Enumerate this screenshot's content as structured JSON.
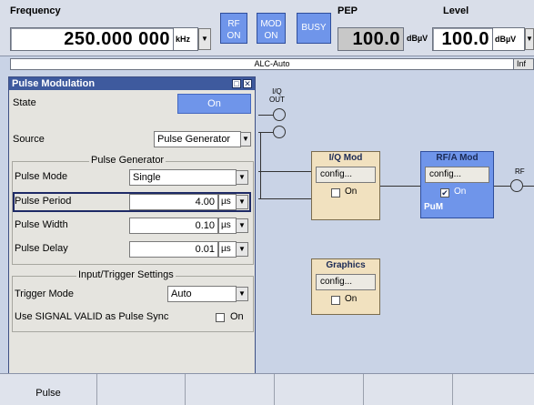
{
  "header": {
    "frequency_label": "Frequency",
    "frequency_value": "250.000 000",
    "frequency_unit": "kHz",
    "rf_button": "RF\nON",
    "mod_button": "MOD\nON",
    "busy_button": "BUSY",
    "pep_label": "PEP",
    "pep_value": "100.0",
    "pep_unit": "dBµV",
    "level_label": "Level",
    "level_value": "100.0",
    "level_unit": "dBµV"
  },
  "alc": {
    "text": "ALC-Auto",
    "info_button": "Inf"
  },
  "dialog": {
    "title": "Pulse Modulation",
    "state_label": "State",
    "state_value": "On",
    "source_label": "Source",
    "source_value": "Pulse Generator",
    "pulse_generator_group": "Pulse Generator",
    "pulse_mode_label": "Pulse Mode",
    "pulse_mode_value": "Single",
    "pulse_period_label": "Pulse Period",
    "pulse_period_value": "4.00",
    "pulse_period_unit": "µs",
    "pulse_width_label": "Pulse Width",
    "pulse_width_value": "0.10",
    "pulse_width_unit": "µs",
    "pulse_delay_label": "Pulse Delay",
    "pulse_delay_value": "0.01",
    "pulse_delay_unit": "µs",
    "trigger_group": "Input/Trigger Settings",
    "trigger_mode_label": "Trigger Mode",
    "trigger_mode_value": "Auto",
    "signal_valid_label": "Use SIGNAL VALID as Pulse Sync",
    "signal_valid_checkbox_label": "On"
  },
  "diagram": {
    "iq_out_label": "I/Q\nOUT",
    "iq_mod_title": "I/Q Mod",
    "iq_mod_config": "config...",
    "iq_mod_on": "On",
    "rfa_mod_title": "RF/A Mod",
    "rfa_mod_config": "config...",
    "rfa_mod_on": "On",
    "rfa_mod_pum": "PuM",
    "rf_label": "RF",
    "graphics_title": "Graphics",
    "graphics_config": "config...",
    "graphics_on": "On"
  },
  "softkeys": {
    "key1": "Pulse"
  },
  "colors": {
    "accent_blue": "#6f95ea",
    "title_bar": "#3e5a9e",
    "block_beige": "#f1e1bf",
    "background": "#c9d3e6"
  }
}
